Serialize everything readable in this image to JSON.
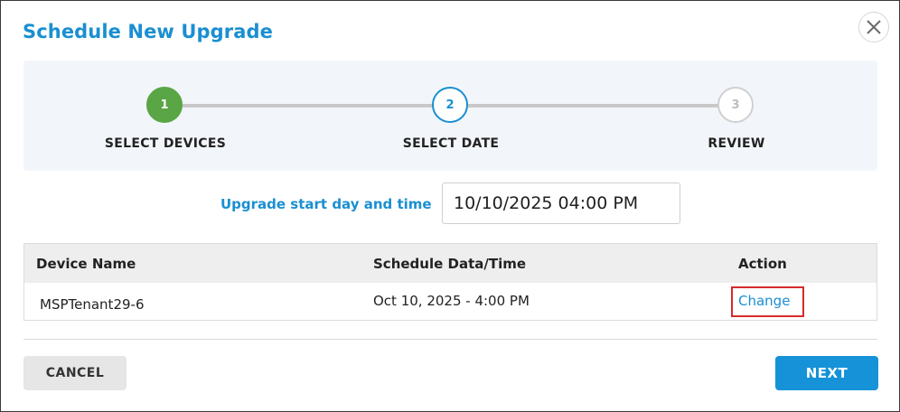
{
  "dialog": {
    "title": "Schedule New Upgrade",
    "close_icon": "close-icon"
  },
  "stepper": {
    "steps": [
      {
        "number": "1",
        "label": "SELECT DEVICES",
        "state": "completed"
      },
      {
        "number": "2",
        "label": "SELECT DATE",
        "state": "active"
      },
      {
        "number": "3",
        "label": "REVIEW",
        "state": "pending"
      }
    ],
    "colors": {
      "completed": "#5aa545",
      "active": "#1a8fd1",
      "pending": "#d0d0d0"
    }
  },
  "schedule": {
    "label": "Upgrade start day and time",
    "value": "10/10/2025 04:00 PM"
  },
  "table": {
    "headers": {
      "device": "Device Name",
      "schedule": "Schedule Data/Time",
      "action": "Action"
    },
    "rows": [
      {
        "device": "MSPTenant29-6",
        "schedule": "Oct 10, 2025 - 4:00 PM",
        "action": "Change"
      }
    ]
  },
  "footer": {
    "cancel_label": "CANCEL",
    "next_label": "NEXT"
  },
  "colors": {
    "accent": "#1a8fd1",
    "highlight": "#d62b2b"
  }
}
